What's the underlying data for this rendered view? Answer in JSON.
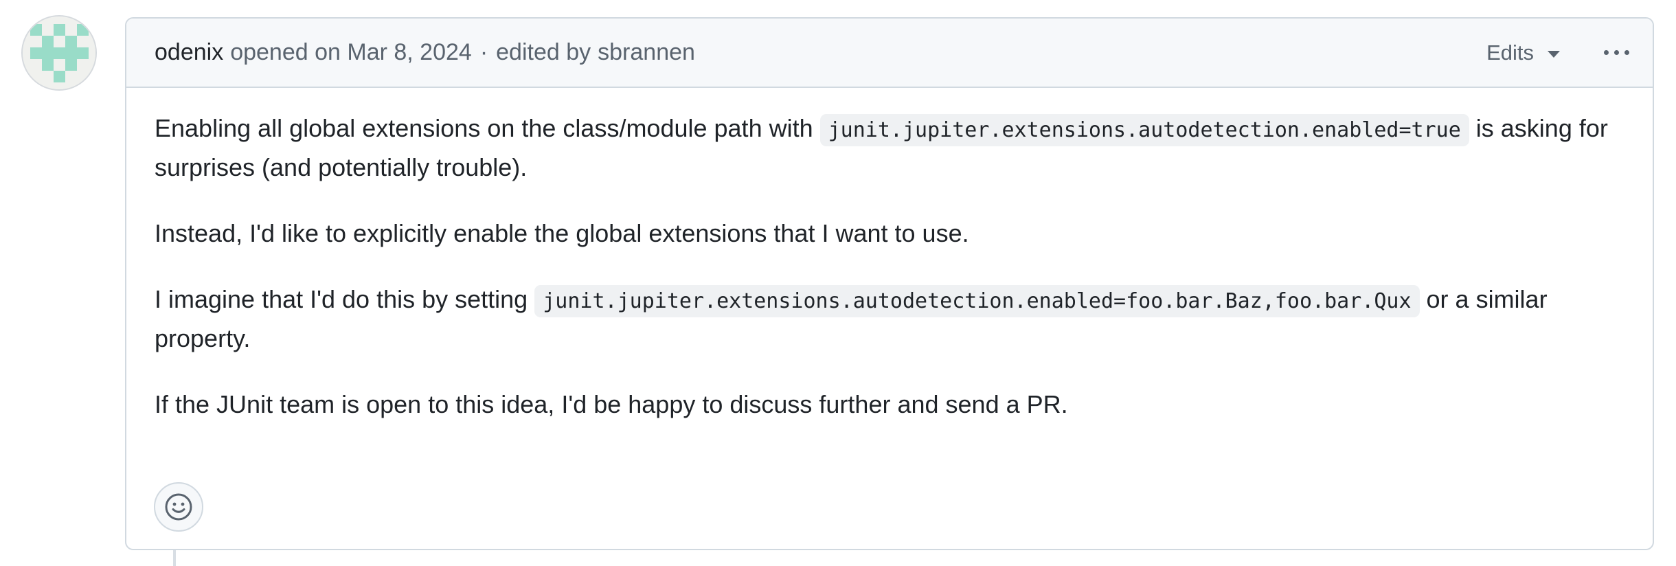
{
  "comment": {
    "author": "odenix",
    "opened_text": "opened on Mar 8, 2024",
    "separator": "·",
    "edited_prefix": "edited by",
    "editor": "sbrannen",
    "edits_label": "Edits",
    "more_icon": "kebab-horizontal-icon",
    "avatar_icon": "identicon",
    "avatar_color": "#99dcc8",
    "body": {
      "p1_before": "Enabling all global extensions on the class/module path with",
      "p1_code": "junit.jupiter.extensions.autodetection.enabled=true",
      "p1_after": "is asking for surprises (and potentially trouble).",
      "p2": "Instead, I'd like to explicitly enable the global extensions that I want to use.",
      "p3_before": "I imagine that I'd do this by setting",
      "p3_code": "junit.jupiter.extensions.autodetection.enabled=foo.bar.Baz,foo.bar.Qux",
      "p3_after": "or a similar property.",
      "p4": "If the JUnit team is open to this idea, I'd be happy to discuss further and send a PR."
    },
    "reaction_icon": "smiley-icon"
  }
}
